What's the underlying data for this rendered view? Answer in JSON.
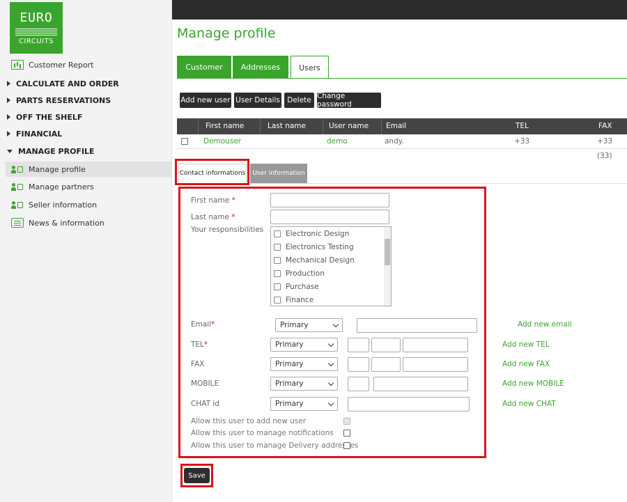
{
  "brand": {
    "line1": "EURO",
    "line2": "CIRCUITS",
    "color": "#3aa52c"
  },
  "sidebar": {
    "customer_report": "Customer Report",
    "groups": [
      "CALCULATE AND ORDER",
      "PARTS RESERVATIONS",
      "OFF THE SHELF",
      "FINANCIAL",
      "MANAGE PROFILE"
    ],
    "subitems": [
      "Manage profile",
      "Manage partners",
      "Seller information",
      "News & information"
    ],
    "active_item": "Manage profile"
  },
  "page_title": "Manage profile",
  "tabs": [
    "Customer",
    "Addresses",
    "Users"
  ],
  "active_tab": "Users",
  "actions": [
    "Add new user",
    "User Details",
    "Delete",
    "Change password"
  ],
  "users_table": {
    "headers": [
      "First name",
      "Last name",
      "User name",
      "Email",
      "TEL",
      "FAX"
    ],
    "rows": [
      {
        "first_name": "Demouser",
        "last_name": "",
        "user_name": "demo",
        "email": "andy.",
        "tel": "+33",
        "fax": "+33 (33)"
      }
    ]
  },
  "subtabs": [
    "Contact informations",
    "User information"
  ],
  "active_subtab": "Contact informations",
  "form": {
    "first_name_label": "First name",
    "last_name_label": "Last name",
    "responsibilities_label": "Your responsibilities",
    "responsibilities": [
      "Electronic Design",
      "Electronics Testing",
      "Mechanical Design",
      "Production",
      "Purchase",
      "Finance"
    ],
    "email_label": "Email",
    "tel_label": "TEL",
    "fax_label": "FAX",
    "mobile_label": "MOBILE",
    "chat_label": "CHAT id",
    "type_value": "Primary",
    "add_email": "Add new email",
    "add_tel": "Add new TEL",
    "add_fax": "Add new FAX",
    "add_mobile": "Add new MOBILE",
    "add_chat": "Add new CHAT",
    "perm_add_user": "Allow this user to add new user",
    "perm_notifications": "Allow this user to manage notifications",
    "perm_delivery": "Allow this user to manage Delivery addresses",
    "required_mark": "*"
  },
  "save_label": "Save",
  "colors": {
    "accent": "#3aa52c",
    "highlight": "#d9141b",
    "dark_button": "#2d2d2d"
  }
}
